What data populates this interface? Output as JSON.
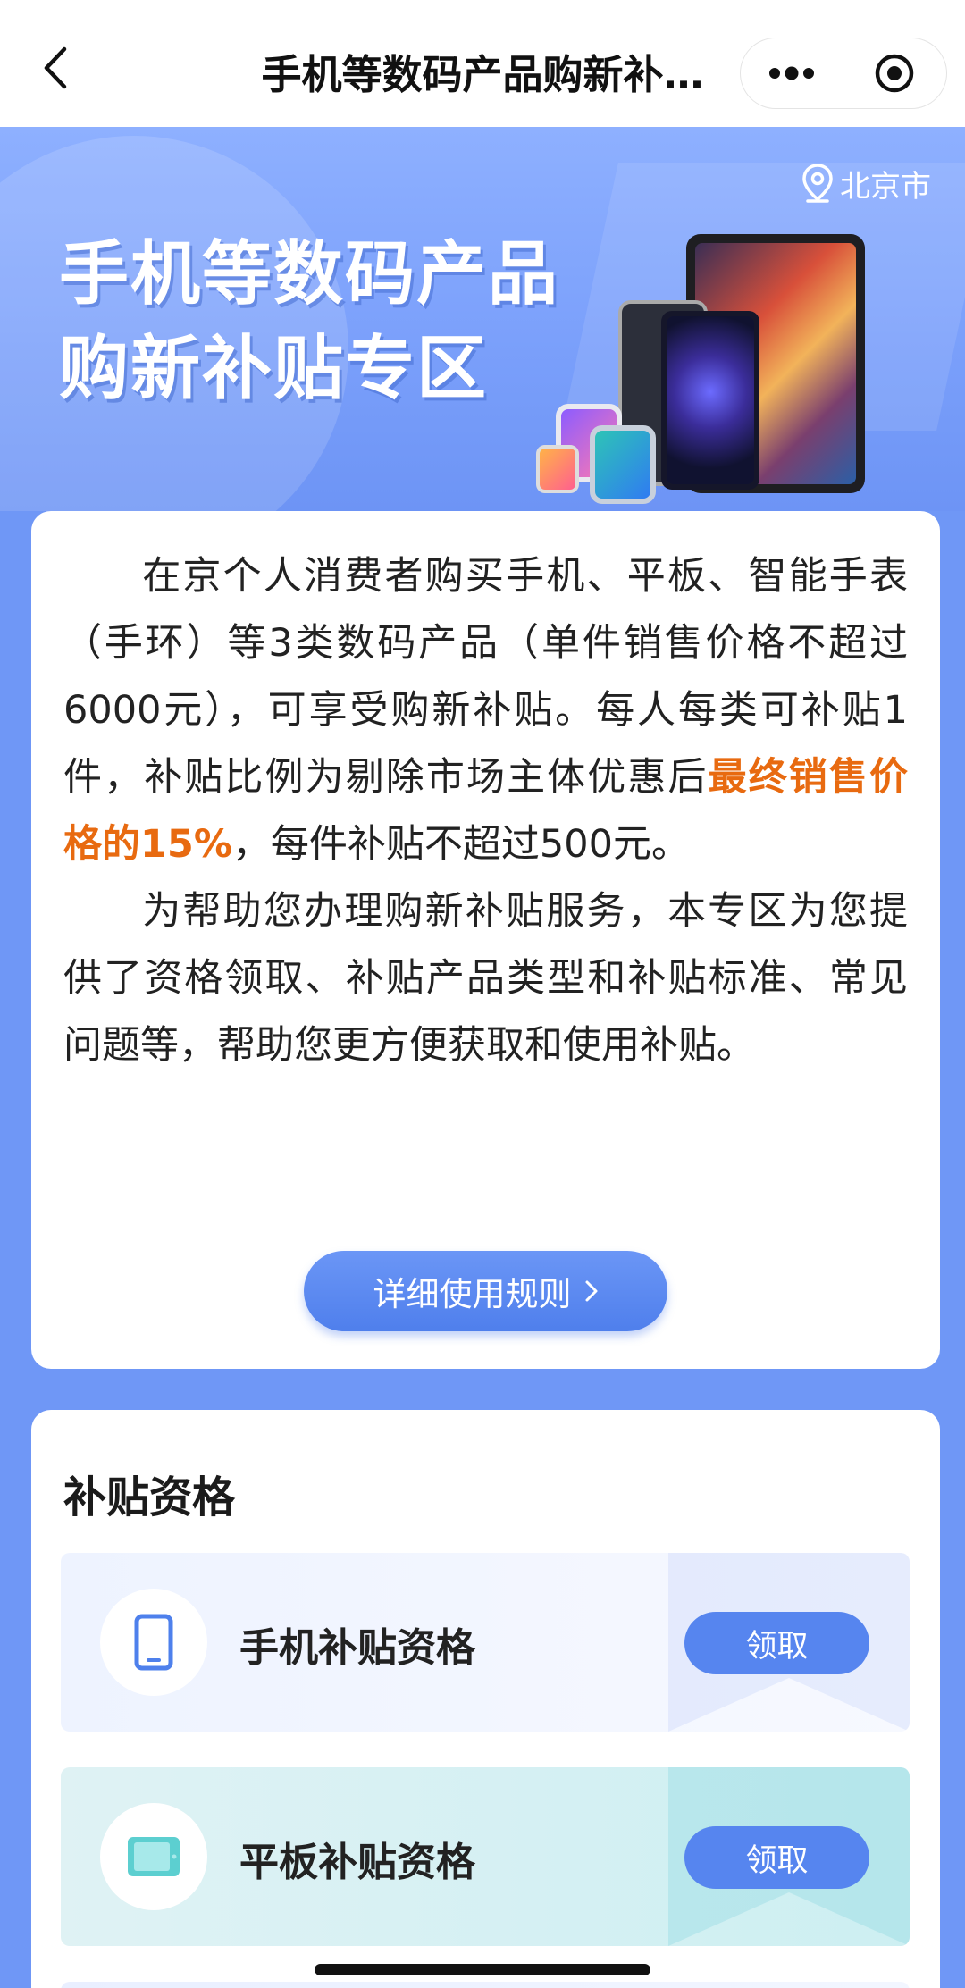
{
  "navbar": {
    "title": "手机等数码产品购新补…",
    "more_icon": "more-dots-icon",
    "close_icon": "target-close-icon"
  },
  "hero": {
    "location": "北京市",
    "title_line1": "手机等数码产品",
    "title_line2": "购新补贴专区"
  },
  "intro": {
    "para1_before": "在京个人消费者购买手机、平板、智能手表（手环）等3类数码产品（单件销售价格不超过6000元），可享受购新补贴。每人每类可补贴1件，补贴比例为剔除市场主体优惠后",
    "para1_highlight": "最终销售价格的15%",
    "para1_after": "，每件补贴不超过500元。",
    "para2": "为帮助您办理购新补贴服务，本专区为您提供了资格领取、补贴产品类型和补贴标准、常见问题等，帮助您更方便获取和使用补贴。",
    "rules_button": "详细使用规则",
    "rules_button_icon": "chevron-right-icon"
  },
  "eligibility": {
    "title": "补贴资格",
    "items": [
      {
        "label": "手机补贴资格",
        "button": "领取",
        "icon": "phone-icon"
      },
      {
        "label": "平板补贴资格",
        "button": "领取",
        "icon": "tablet-icon"
      }
    ]
  },
  "colors": {
    "accent": "#5685ef",
    "highlight": "#e86a10",
    "background": "#6f97f6"
  }
}
